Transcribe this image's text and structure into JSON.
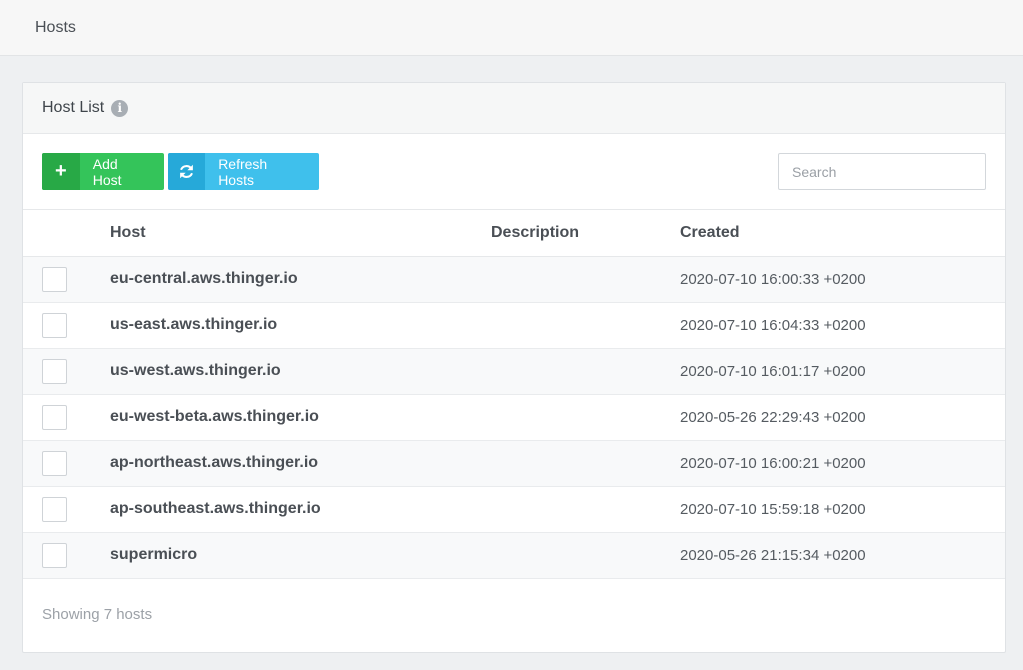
{
  "page": {
    "title": "Hosts"
  },
  "panel": {
    "title": "Host List"
  },
  "toolbar": {
    "add_label": "Add Host",
    "refresh_label": "Refresh Hosts",
    "search_placeholder": "Search",
    "search_value": ""
  },
  "table": {
    "columns": [
      "Host",
      "Description",
      "Created"
    ],
    "rows": [
      {
        "host": "eu-central.aws.thinger.io",
        "description": "",
        "created": "2020-07-10 16:00:33 +0200"
      },
      {
        "host": "us-east.aws.thinger.io",
        "description": "",
        "created": "2020-07-10 16:04:33 +0200"
      },
      {
        "host": "us-west.aws.thinger.io",
        "description": "",
        "created": "2020-07-10 16:01:17 +0200"
      },
      {
        "host": "eu-west-beta.aws.thinger.io",
        "description": "",
        "created": "2020-05-26 22:29:43 +0200"
      },
      {
        "host": "ap-northeast.aws.thinger.io",
        "description": "",
        "created": "2020-07-10 16:00:21 +0200"
      },
      {
        "host": "ap-southeast.aws.thinger.io",
        "description": "",
        "created": "2020-07-10 15:59:18 +0200"
      },
      {
        "host": "supermicro",
        "description": "",
        "created": "2020-05-26 21:15:34 +0200"
      }
    ]
  },
  "footer": {
    "text": "Showing 7 hosts"
  },
  "icons": {
    "info": "info-icon",
    "add": "plus-icon",
    "refresh": "refresh-icon"
  },
  "colors": {
    "add_button": "#34c45a",
    "refresh_button": "#3fc0ec"
  }
}
